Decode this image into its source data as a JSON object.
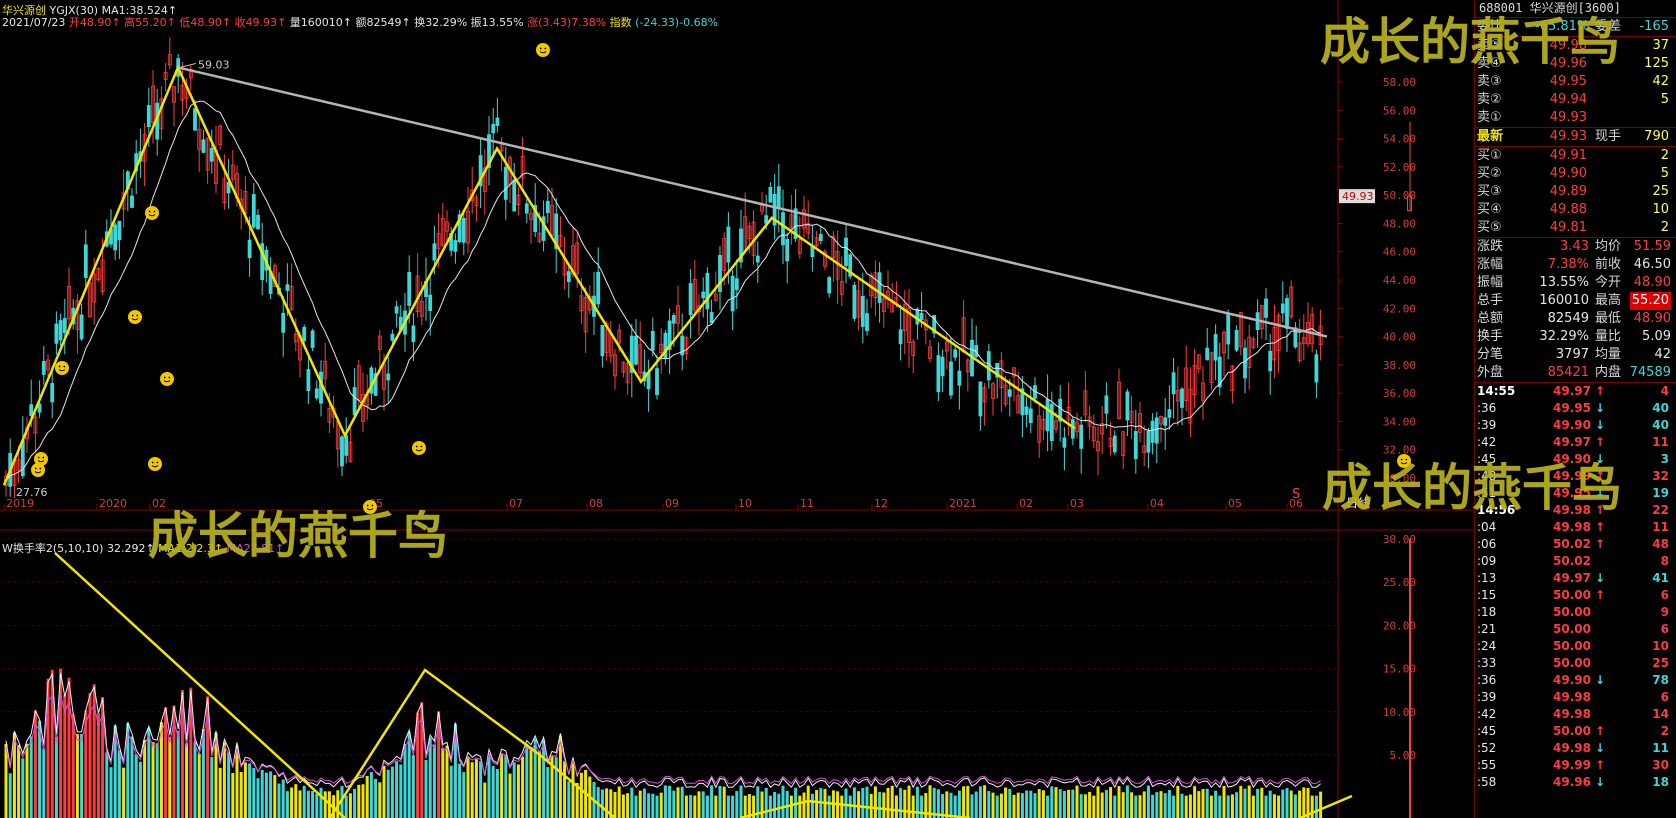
{
  "header": {
    "stock_name": "华兴源创",
    "indicator": "YGJX(30)",
    "ma1": "MA1:38.524",
    "ma1_arrow": "↑",
    "date": "2021/07/23",
    "open": "开48.90",
    "open_arrow": "↑",
    "high": "高55.20",
    "high_arrow": "↑",
    "low": "低48.90",
    "low_arrow": "↑",
    "close": "收49.93",
    "close_arrow": "↑",
    "volume": "量160010",
    "volume_arrow": "↑",
    "amount": "额82549",
    "amount_arrow": "↑",
    "turnover": "换32.29%",
    "amplitude": "振13.55%",
    "change": "涨(3.43)7.38%",
    "index": "指数",
    "index_change": "(-24.33)-0.68%"
  },
  "sub_chart": {
    "title": "W换手率2(5,10,10)",
    "value": "32.292",
    "value_arrow": "↑",
    "ma1": "MA1:",
    "ma1_value": "2.2.3",
    "ma1_arrow": "↑",
    "ma2": "MA2",
    "ma2_value": "7.81",
    "ma2_arrow": "↑"
  },
  "watermark": "成长的燕千鸟",
  "main_chart": {
    "y_ticks": [
      "58.00",
      "56.00",
      "54.00",
      "52.00",
      "50.00",
      "48.00",
      "46.00",
      "44.00",
      "42.00",
      "40.00",
      "38.00",
      "36.00",
      "34.00",
      "32.00",
      "30.00"
    ],
    "x_labels": [
      "2019",
      "2020",
      "02",
      "05",
      "07",
      "08",
      "09",
      "10",
      "11",
      "12",
      "2021",
      "02",
      "03",
      "04",
      "05",
      "06",
      "07"
    ],
    "x_axis_name": "日线",
    "high_label": "59.03",
    "low_label": "27.76",
    "price_tag": "49.93",
    "event_marker": "S"
  },
  "sub_y_ticks": [
    "30.00",
    "25.00",
    "20.00",
    "15.00",
    "10.00",
    "5.00"
  ],
  "colors": {
    "up": "#ff3c3c",
    "down": "#3cd7d7",
    "trend": "#f0e600",
    "resist": "#b4b4b4",
    "ma": "#e6e6e6",
    "grid": "#8b0000"
  },
  "chart_data": {
    "type": "line",
    "title": "",
    "xlabel": "",
    "ylabel": "",
    "ylim": [
      29,
      60
    ],
    "series": [
      {
        "values": [
          29.5,
          59.03,
          33.0,
          53.3,
          36.8,
          48.4,
          33.5
        ]
      },
      {
        "values": [
          59.03,
          40.0
        ]
      }
    ]
  },
  "quote": {
    "title": "688001 华兴源创[3600]",
    "wei_bi_label": "委比",
    "wei_bi": "-65.81%",
    "wei_cha_label": "委差",
    "wei_cha": "-165",
    "asks": [
      {
        "label": "卖⑤",
        "price": "49.98",
        "vol": "37"
      },
      {
        "label": "卖④",
        "price": "49.96",
        "vol": "125"
      },
      {
        "label": "卖③",
        "price": "49.95",
        "vol": "42"
      },
      {
        "label": "卖②",
        "price": "49.94",
        "vol": "5"
      },
      {
        "label": "卖①",
        "price": "49.93",
        "vol": ""
      }
    ],
    "last_label": "最新",
    "last_price": "49.93",
    "current_hand_label": "现手",
    "current_hand": "790",
    "bids": [
      {
        "label": "买①",
        "price": "49.91",
        "vol": "2"
      },
      {
        "label": "买②",
        "price": "49.90",
        "vol": "5"
      },
      {
        "label": "买③",
        "price": "49.89",
        "vol": "25"
      },
      {
        "label": "买④",
        "price": "49.88",
        "vol": "10"
      },
      {
        "label": "买⑤",
        "price": "49.81",
        "vol": "2"
      }
    ],
    "stats": [
      {
        "l1": "涨跌",
        "v1": "3.43",
        "c1": "#ff3c3c",
        "l2": "均价",
        "v2": "51.59",
        "c2": "#ff3c3c",
        "hl2": false
      },
      {
        "l1": "涨幅",
        "v1": "7.38%",
        "c1": "#ff3c3c",
        "l2": "前收",
        "v2": "46.50",
        "c2": "#e6e6e6",
        "hl2": false
      },
      {
        "l1": "振幅",
        "v1": "13.55%",
        "c1": "#e6e6e6",
        "l2": "今开",
        "v2": "48.90",
        "c2": "#ff3c3c",
        "hl2": false
      },
      {
        "l1": "总手",
        "v1": "160010",
        "c1": "#e6e6e6",
        "l2": "最高",
        "v2": "55.20",
        "c2": "#ffffff",
        "hl2": true
      },
      {
        "l1": "总额",
        "v1": "82549",
        "c1": "#e6e6e6",
        "l2": "最低",
        "v2": "48.90",
        "c2": "#ff3c3c",
        "hl2": false
      },
      {
        "l1": "换手",
        "v1": "32.29%",
        "c1": "#e6e6e6",
        "l2": "量比",
        "v2": "5.09",
        "c2": "#e6e6e6",
        "hl2": false
      },
      {
        "l1": "分笔",
        "v1": "3797",
        "c1": "#e6e6e6",
        "l2": "均量",
        "v2": "42",
        "c2": "#e6e6e6",
        "hl2": false
      },
      {
        "l1": "外盘",
        "v1": "85421",
        "c1": "#ff3c3c",
        "l2": "内盘",
        "v2": "74589",
        "c2": "#3cd7d7",
        "hl2": false
      }
    ],
    "ticks": [
      {
        "t": "14:55",
        "p": "49.97",
        "a": "↑",
        "v": "4",
        "dir": "up",
        "bold_time": true
      },
      {
        "t": ":36",
        "p": "49.95",
        "a": "↓",
        "v": "40",
        "dir": "down"
      },
      {
        "t": ":39",
        "p": "49.90",
        "a": "↓",
        "v": "40",
        "dir": "down"
      },
      {
        "t": ":42",
        "p": "49.97",
        "a": "↑",
        "v": "11",
        "dir": "up"
      },
      {
        "t": ":45",
        "p": "49.90",
        "a": "↓",
        "v": "3",
        "dir": "down"
      },
      {
        "t": ":48",
        "p": "49.99",
        "a": "↑",
        "v": "32",
        "dir": "up"
      },
      {
        "t": ":51",
        "p": "49.95",
        "a": "↓",
        "v": "19",
        "dir": "down"
      },
      {
        "t": "14:56",
        "p": "49.98",
        "a": "↑",
        "v": "22",
        "dir": "up",
        "bold_time": true
      },
      {
        "t": ":04",
        "p": "49.98",
        "a": "↑",
        "v": "11",
        "dir": "up"
      },
      {
        "t": ":06",
        "p": "50.02",
        "a": "↑",
        "v": "48",
        "dir": "up"
      },
      {
        "t": ":09",
        "p": "50.02",
        "a": "",
        "v": "8",
        "dir": "up"
      },
      {
        "t": ":13",
        "p": "49.97",
        "a": "↓",
        "v": "41",
        "dir": "down"
      },
      {
        "t": ":15",
        "p": "50.00",
        "a": "↑",
        "v": "6",
        "dir": "up"
      },
      {
        "t": ":18",
        "p": "50.00",
        "a": "",
        "v": "9",
        "dir": "up"
      },
      {
        "t": ":21",
        "p": "50.00",
        "a": "",
        "v": "6",
        "dir": "up"
      },
      {
        "t": ":24",
        "p": "50.00",
        "a": "",
        "v": "10",
        "dir": "up"
      },
      {
        "t": ":33",
        "p": "50.00",
        "a": "",
        "v": "25",
        "dir": "up"
      },
      {
        "t": ":36",
        "p": "49.90",
        "a": "↓",
        "v": "78",
        "dir": "down"
      },
      {
        "t": ":39",
        "p": "49.98",
        "a": "",
        "v": "6",
        "dir": "up"
      },
      {
        "t": ":42",
        "p": "49.98",
        "a": "",
        "v": "14",
        "dir": "up"
      },
      {
        "t": ":45",
        "p": "50.00",
        "a": "↑",
        "v": "2",
        "dir": "up"
      },
      {
        "t": ":52",
        "p": "49.98",
        "a": "↓",
        "v": "11",
        "dir": "down"
      },
      {
        "t": ":55",
        "p": "49.99",
        "a": "↑",
        "v": "30",
        "dir": "up"
      },
      {
        "t": ":58",
        "p": "49.96",
        "a": "↓",
        "v": "18",
        "dir": "down"
      }
    ]
  }
}
